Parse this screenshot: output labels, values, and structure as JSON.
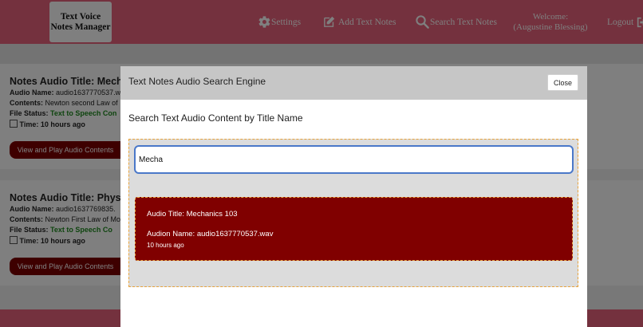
{
  "brand": {
    "line1": "Text Voice",
    "line2": "Notes Manager"
  },
  "nav": {
    "settings": "Settings",
    "add_notes": "Add Text Notes",
    "search_notes": "Search Text Notes",
    "welcome_line1": "Welcome:",
    "welcome_line2": "(Augustine Blessing)",
    "logout": "Logout"
  },
  "cards": [
    {
      "title": "Notes Audio Title: Mecha",
      "audio_label": "Audio Name:",
      "audio_value": "audio1637770537.w",
      "contents_label": "Contents:",
      "contents_value": "Newton second Law of",
      "status_label": "File Status:",
      "status_value": "Text to Speech Con",
      "time": "Time: 10 hours ago",
      "button": "View and Play Audio Contents"
    },
    {
      "title": "Notes Audio Title: Physic",
      "audio_label": "Audio Name:",
      "audio_value": "audio1637769835.",
      "contents_label": "Contents:",
      "contents_value": "Newton First Law of Mo",
      "status_label": "File Status:",
      "status_value": "Text to Speech Co",
      "time": "Time: 10 hours ago",
      "button": "View and Play Audio Contents"
    }
  ],
  "modal": {
    "title": "Text Notes Audio Search Engine",
    "close": "Close",
    "subtitle": "Search Text Audio Content by Title Name",
    "search_value": "Mecha",
    "result": {
      "title": "Audio Title: Mechanics 103",
      "name": "Audion Name: audio1637770537.wav",
      "time": "10 hours ago"
    }
  },
  "colors": {
    "nav_bg": "#e8627c",
    "result_bg": "#800000",
    "button_bg": "#7d0000",
    "status_green": "#1f8a1f",
    "dashed_border": "#e8a33c",
    "input_border": "#4a78c9"
  }
}
